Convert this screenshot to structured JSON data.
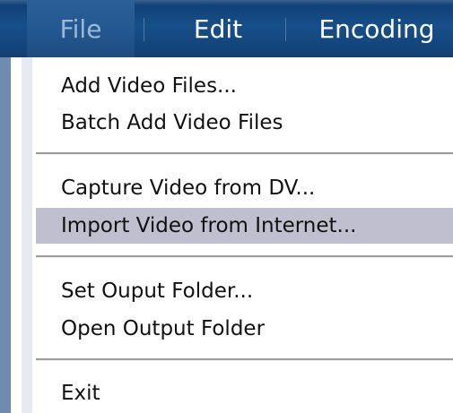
{
  "menubar": {
    "items": [
      {
        "label": "File"
      },
      {
        "label": "Edit"
      },
      {
        "label": "Encoding"
      }
    ]
  },
  "file_menu": {
    "groups": [
      [
        {
          "label": "Add Video Files..."
        },
        {
          "label": "Batch Add Video Files"
        }
      ],
      [
        {
          "label": "Capture Video from DV..."
        },
        {
          "label": "Import Video from Internet...",
          "highlighted": true
        }
      ],
      [
        {
          "label": "Set Ouput Folder..."
        },
        {
          "label": "Open Output Folder"
        }
      ],
      [
        {
          "label": "Exit"
        }
      ]
    ]
  },
  "colors": {
    "menubar_bg": "#164f8a",
    "menubar_active_text": "#9db7d6",
    "highlight_bg": "#bfbfcf",
    "divider": "#9c9c9c"
  }
}
